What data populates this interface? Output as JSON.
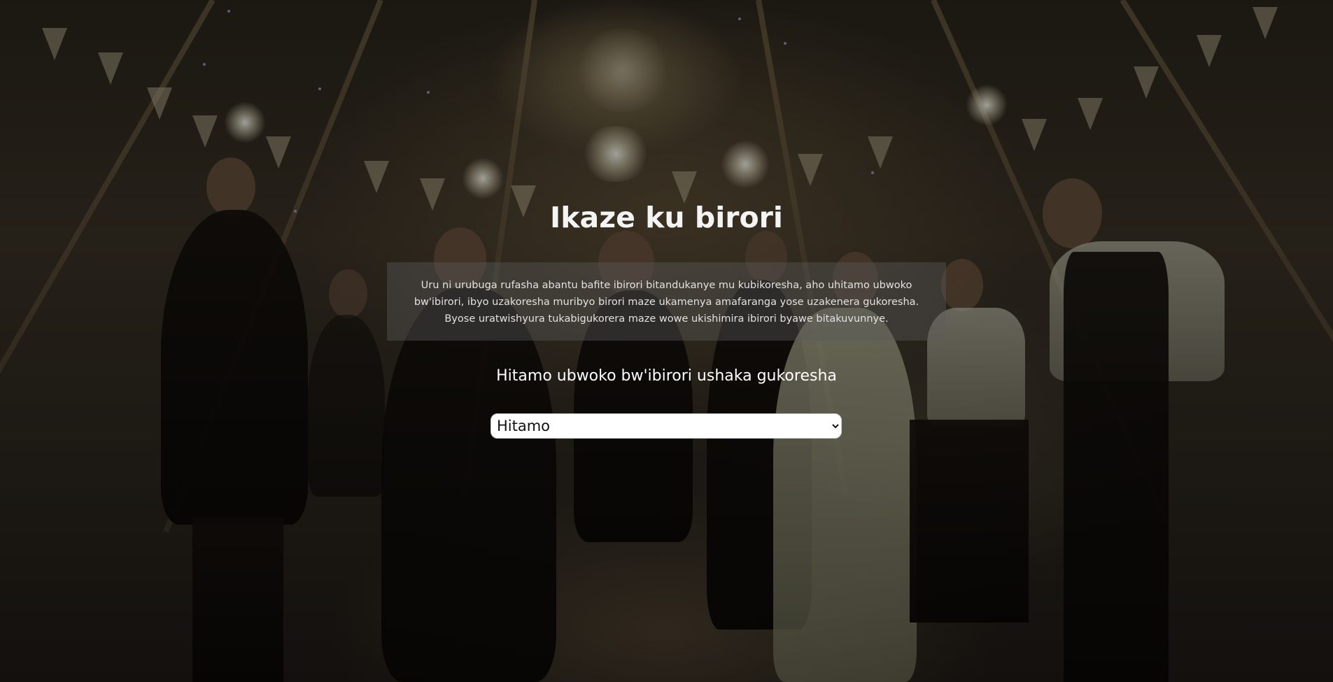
{
  "page": {
    "title": "Ikaze ku birori",
    "description": "Uru ni urubuga rufasha abantu bafite ibirori bitandukanye mu kubikoresha, aho uhitamo ubwoko bw'ibirori, ibyo uzakoresha muribyo birori maze ukamenya amafaranga yose uzakenera gukoresha. Byose uratwishyura tukabigukorera maze wowe ukishimira ibirori byawe bitakuvunnye.",
    "prompt": "Hitamo ubwoko bw'ibirori ushaka gukoresha"
  },
  "event_type_select": {
    "selected": "Hitamo"
  },
  "background": {
    "image": "dancing-party-in-tent",
    "overlay_color": "#000000"
  }
}
